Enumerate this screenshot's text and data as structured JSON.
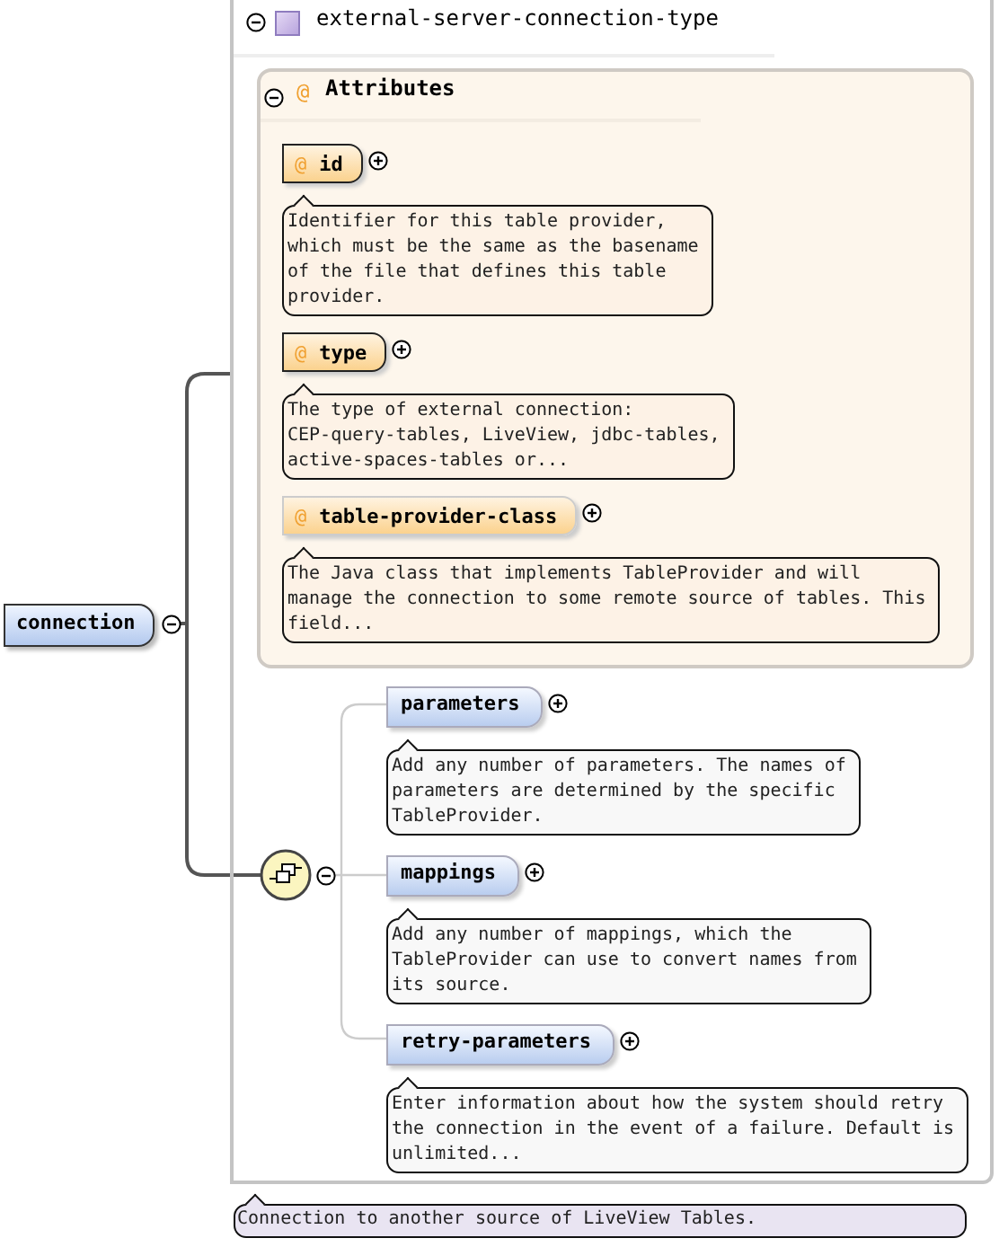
{
  "root": {
    "name": "connection",
    "expanded": true,
    "documentation": "Connection to another source of LiveView Tables."
  },
  "type": {
    "name": "external-server-connection-type",
    "expanded": true
  },
  "attributes": {
    "marker": "@",
    "label": "Attributes",
    "expanded": true,
    "items": [
      {
        "marker": "@",
        "name": "id",
        "required": true,
        "expanded": false,
        "documentation": "Identifier for this table provider,\nwhich must be the same as the basename\nof the file that defines this table\nprovider."
      },
      {
        "marker": "@",
        "name": "type",
        "required": true,
        "expanded": false,
        "documentation": "The type of external connection:\nCEP-query-tables, LiveView, jdbc-tables,\nactive-spaces-tables or..."
      },
      {
        "marker": "@",
        "name": "table-provider-class",
        "required": false,
        "expanded": false,
        "documentation": "The Java class that implements TableProvider and will\nmanage the connection to some remote source of tables. This\nfield..."
      }
    ]
  },
  "sequence": {
    "expanded": true,
    "elements": [
      {
        "name": "parameters",
        "expanded": false,
        "documentation": "Add any number of parameters. The names of\nparameters are determined by the specific\nTableProvider."
      },
      {
        "name": "mappings",
        "expanded": false,
        "documentation": "Add any number of mappings, which the\nTableProvider can use to convert names from\nits source."
      },
      {
        "name": "retry-parameters",
        "expanded": false,
        "documentation": "Enter information about how the system should retry\nthe connection in the event of a failure. Default is\nunlimited..."
      }
    ]
  }
}
